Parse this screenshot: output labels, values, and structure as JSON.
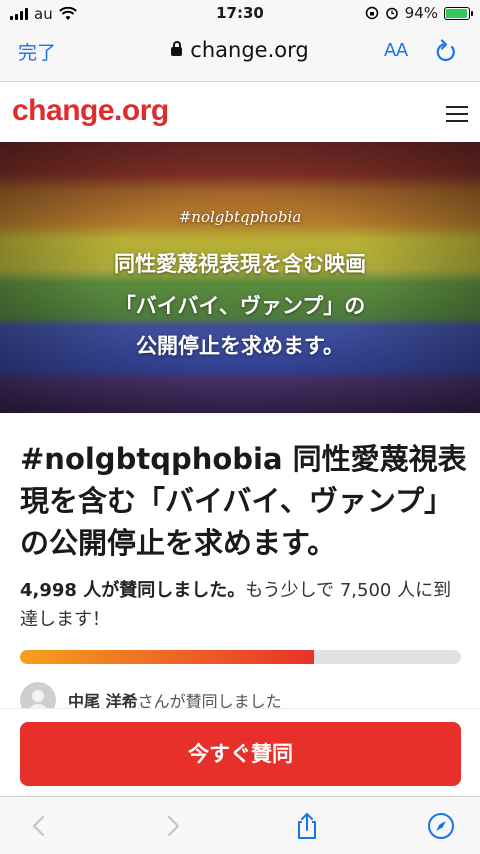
{
  "status_bar": {
    "carrier": "au",
    "time": "17:30",
    "battery": "94%",
    "battery_level": 0.94
  },
  "browser": {
    "done_label": "完了",
    "url": "change.org",
    "text_size_label": "AA"
  },
  "site": {
    "logo": "change.org"
  },
  "hero": {
    "hashtag": "#nolgbtqphobia",
    "line1": "同性愛蔑視表現を含む映画",
    "line2": "「バイバイ、ヴァンプ」の",
    "line3": "公開停止を求めます。"
  },
  "petition": {
    "title": "#nolgbtqphobia 同性愛蔑視表現を含む「バイバイ、ヴァンプ」の公開停止を求めます。",
    "signers_count": "4,998 人が賛同しました。",
    "signers_goal": "もう少しで 7,500 人に到達します！",
    "progress_fraction": 0.666,
    "recent_signer_name": "中尾 洋希",
    "recent_signer_text": "さんが賛同しました",
    "cta_label": "今すぐ賛同"
  },
  "colors": {
    "brand": "#e02c2c",
    "cta": "#e7302a",
    "ios_blue": "#1a73e8"
  }
}
